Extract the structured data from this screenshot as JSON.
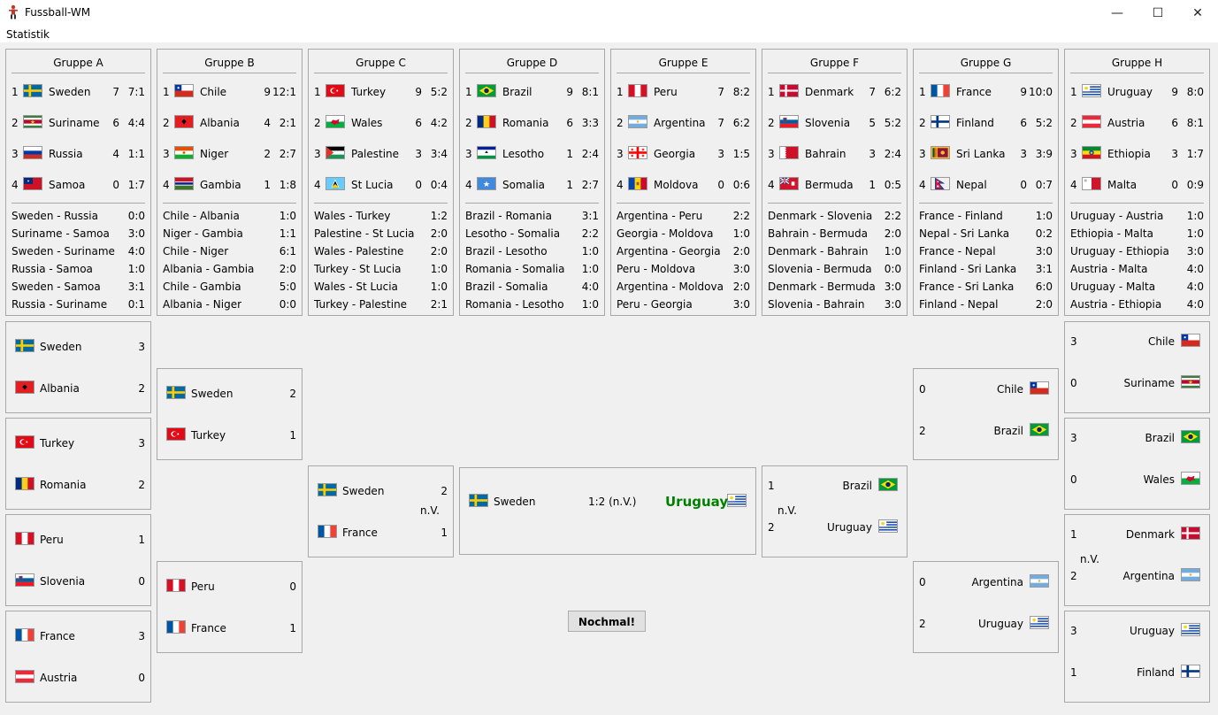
{
  "window": {
    "title": "Fussball-WM",
    "icon": "player-icon",
    "minimize": "—",
    "maximize": "☐",
    "close": "✕"
  },
  "menu": {
    "statistik": "Statistik"
  },
  "groups": [
    {
      "title": "Gruppe A",
      "standings": [
        {
          "pos": "1",
          "team": "Sweden",
          "pts": "7",
          "goals": "7:1"
        },
        {
          "pos": "2",
          "team": "Suriname",
          "pts": "6",
          "goals": "4:4"
        },
        {
          "pos": "3",
          "team": "Russia",
          "pts": "4",
          "goals": "1:1"
        },
        {
          "pos": "4",
          "team": "Samoa",
          "pts": "0",
          "goals": "1:7"
        }
      ],
      "matches": [
        {
          "pair": "Sweden - Russia",
          "result": "0:0"
        },
        {
          "pair": "Suriname - Samoa",
          "result": "3:0"
        },
        {
          "pair": "Sweden - Suriname",
          "result": "4:0"
        },
        {
          "pair": "Russia - Samoa",
          "result": "1:0"
        },
        {
          "pair": "Sweden - Samoa",
          "result": "3:1"
        },
        {
          "pair": "Russia - Suriname",
          "result": "0:1"
        }
      ]
    },
    {
      "title": "Gruppe B",
      "standings": [
        {
          "pos": "1",
          "team": "Chile",
          "pts": "9",
          "goals": "12:1"
        },
        {
          "pos": "2",
          "team": "Albania",
          "pts": "4",
          "goals": "2:1"
        },
        {
          "pos": "3",
          "team": "Niger",
          "pts": "2",
          "goals": "2:7"
        },
        {
          "pos": "4",
          "team": "Gambia",
          "pts": "1",
          "goals": "1:8"
        }
      ],
      "matches": [
        {
          "pair": "Chile - Albania",
          "result": "1:0"
        },
        {
          "pair": "Niger - Gambia",
          "result": "1:1"
        },
        {
          "pair": "Chile - Niger",
          "result": "6:1"
        },
        {
          "pair": "Albania - Gambia",
          "result": "2:0"
        },
        {
          "pair": "Chile - Gambia",
          "result": "5:0"
        },
        {
          "pair": "Albania - Niger",
          "result": "0:0"
        }
      ]
    },
    {
      "title": "Gruppe C",
      "standings": [
        {
          "pos": "1",
          "team": "Turkey",
          "pts": "9",
          "goals": "5:2"
        },
        {
          "pos": "2",
          "team": "Wales",
          "pts": "6",
          "goals": "4:2"
        },
        {
          "pos": "3",
          "team": "Palestine",
          "pts": "3",
          "goals": "3:4"
        },
        {
          "pos": "4",
          "team": "St Lucia",
          "pts": "0",
          "goals": "0:4"
        }
      ],
      "matches": [
        {
          "pair": "Wales - Turkey",
          "result": "1:2"
        },
        {
          "pair": "Palestine - St Lucia",
          "result": "2:0"
        },
        {
          "pair": "Wales - Palestine",
          "result": "2:0"
        },
        {
          "pair": "Turkey - St Lucia",
          "result": "1:0"
        },
        {
          "pair": "Wales - St Lucia",
          "result": "1:0"
        },
        {
          "pair": "Turkey - Palestine",
          "result": "2:1"
        }
      ]
    },
    {
      "title": "Gruppe D",
      "standings": [
        {
          "pos": "1",
          "team": "Brazil",
          "pts": "9",
          "goals": "8:1"
        },
        {
          "pos": "2",
          "team": "Romania",
          "pts": "6",
          "goals": "3:3"
        },
        {
          "pos": "3",
          "team": "Lesotho",
          "pts": "1",
          "goals": "2:4"
        },
        {
          "pos": "4",
          "team": "Somalia",
          "pts": "1",
          "goals": "2:7"
        }
      ],
      "matches": [
        {
          "pair": "Brazil - Romania",
          "result": "3:1"
        },
        {
          "pair": "Lesotho - Somalia",
          "result": "2:2"
        },
        {
          "pair": "Brazil - Lesotho",
          "result": "1:0"
        },
        {
          "pair": "Romania - Somalia",
          "result": "1:0"
        },
        {
          "pair": "Brazil - Somalia",
          "result": "4:0"
        },
        {
          "pair": "Romania - Lesotho",
          "result": "1:0"
        }
      ]
    },
    {
      "title": "Gruppe E",
      "standings": [
        {
          "pos": "1",
          "team": "Peru",
          "pts": "7",
          "goals": "8:2"
        },
        {
          "pos": "2",
          "team": "Argentina",
          "pts": "7",
          "goals": "6:2"
        },
        {
          "pos": "3",
          "team": "Georgia",
          "pts": "3",
          "goals": "1:5"
        },
        {
          "pos": "4",
          "team": "Moldova",
          "pts": "0",
          "goals": "0:6"
        }
      ],
      "matches": [
        {
          "pair": "Argentina - Peru",
          "result": "2:2"
        },
        {
          "pair": "Georgia - Moldova",
          "result": "1:0"
        },
        {
          "pair": "Argentina - Georgia",
          "result": "2:0"
        },
        {
          "pair": "Peru - Moldova",
          "result": "3:0"
        },
        {
          "pair": "Argentina - Moldova",
          "result": "2:0"
        },
        {
          "pair": "Peru - Georgia",
          "result": "3:0"
        }
      ]
    },
    {
      "title": "Gruppe F",
      "standings": [
        {
          "pos": "1",
          "team": "Denmark",
          "pts": "7",
          "goals": "6:2"
        },
        {
          "pos": "2",
          "team": "Slovenia",
          "pts": "5",
          "goals": "5:2"
        },
        {
          "pos": "3",
          "team": "Bahrain",
          "pts": "3",
          "goals": "2:4"
        },
        {
          "pos": "4",
          "team": "Bermuda",
          "pts": "1",
          "goals": "0:5"
        }
      ],
      "matches": [
        {
          "pair": "Denmark - Slovenia",
          "result": "2:2"
        },
        {
          "pair": "Bahrain - Bermuda",
          "result": "2:0"
        },
        {
          "pair": "Denmark - Bahrain",
          "result": "1:0"
        },
        {
          "pair": "Slovenia - Bermuda",
          "result": "0:0"
        },
        {
          "pair": "Denmark - Bermuda",
          "result": "3:0"
        },
        {
          "pair": "Slovenia - Bahrain",
          "result": "3:0"
        }
      ]
    },
    {
      "title": "Gruppe G",
      "standings": [
        {
          "pos": "1",
          "team": "France",
          "pts": "9",
          "goals": "10:0"
        },
        {
          "pos": "2",
          "team": "Finland",
          "pts": "6",
          "goals": "5:2"
        },
        {
          "pos": "3",
          "team": "Sri Lanka",
          "pts": "3",
          "goals": "3:9"
        },
        {
          "pos": "4",
          "team": "Nepal",
          "pts": "0",
          "goals": "0:7"
        }
      ],
      "matches": [
        {
          "pair": "France - Finland",
          "result": "1:0"
        },
        {
          "pair": "Nepal - Sri Lanka",
          "result": "0:2"
        },
        {
          "pair": "France - Nepal",
          "result": "3:0"
        },
        {
          "pair": "Finland - Sri Lanka",
          "result": "3:1"
        },
        {
          "pair": "France - Sri Lanka",
          "result": "6:0"
        },
        {
          "pair": "Finland - Nepal",
          "result": "2:0"
        }
      ]
    },
    {
      "title": "Gruppe H",
      "standings": [
        {
          "pos": "1",
          "team": "Uruguay",
          "pts": "9",
          "goals": "8:0"
        },
        {
          "pos": "2",
          "team": "Austria",
          "pts": "6",
          "goals": "8:1"
        },
        {
          "pos": "3",
          "team": "Ethiopia",
          "pts": "3",
          "goals": "1:7"
        },
        {
          "pos": "4",
          "team": "Malta",
          "pts": "0",
          "goals": "0:9"
        }
      ],
      "matches": [
        {
          "pair": "Uruguay - Austria",
          "result": "1:0"
        },
        {
          "pair": "Ethiopia - Malta",
          "result": "1:0"
        },
        {
          "pair": "Uruguay - Ethiopia",
          "result": "3:0"
        },
        {
          "pair": "Austria - Malta",
          "result": "4:0"
        },
        {
          "pair": "Uruguay - Malta",
          "result": "4:0"
        },
        {
          "pair": "Austria - Ethiopia",
          "result": "4:0"
        }
      ]
    }
  ],
  "knockout": {
    "r16_left": [
      {
        "home": "Sweden",
        "home_score": "3",
        "away": "Albania",
        "away_score": "2",
        "note": ""
      },
      {
        "home": "Turkey",
        "home_score": "3",
        "away": "Romania",
        "away_score": "2",
        "note": ""
      },
      {
        "home": "Peru",
        "home_score": "1",
        "away": "Slovenia",
        "away_score": "0",
        "note": ""
      },
      {
        "home": "France",
        "home_score": "3",
        "away": "Austria",
        "away_score": "0",
        "note": ""
      }
    ],
    "qf_left": [
      {
        "home": "Sweden",
        "home_score": "2",
        "away": "Turkey",
        "away_score": "1",
        "note": ""
      },
      {
        "home": "Peru",
        "home_score": "0",
        "away": "France",
        "away_score": "1",
        "note": ""
      }
    ],
    "sf_left": [
      {
        "home": "Sweden",
        "home_score": "2",
        "away": "France",
        "away_score": "1",
        "note": "n.V."
      }
    ],
    "final": {
      "home": "Sweden",
      "score": "1:2 (n.V.)",
      "away": "Uruguay",
      "champion": "Uruguay"
    },
    "sf_right": [
      {
        "home": "Brazil",
        "home_score": "1",
        "away": "Uruguay",
        "away_score": "2",
        "note": "n.V."
      }
    ],
    "qf_right": [
      {
        "home": "Chile",
        "home_score": "0",
        "away": "Brazil",
        "away_score": "2",
        "note": ""
      },
      {
        "home": "Argentina",
        "home_score": "0",
        "away": "Uruguay",
        "away_score": "2",
        "note": ""
      }
    ],
    "r16_right": [
      {
        "home": "Chile",
        "home_score": "3",
        "away": "Suriname",
        "away_score": "0",
        "note": ""
      },
      {
        "home": "Brazil",
        "home_score": "3",
        "away": "Wales",
        "away_score": "0",
        "note": ""
      },
      {
        "home": "Denmark",
        "home_score": "1",
        "away": "Argentina",
        "away_score": "2",
        "note": "n.V."
      },
      {
        "home": "Uruguay",
        "home_score": "3",
        "away": "Finland",
        "away_score": "1",
        "note": ""
      }
    ]
  },
  "button": {
    "again": "Nochmal!"
  },
  "flag_icons": {
    "Sweden": "sweden-flag-icon",
    "Suriname": "suriname-flag-icon",
    "Russia": "russia-flag-icon",
    "Samoa": "samoa-flag-icon",
    "Chile": "chile-flag-icon",
    "Albania": "albania-flag-icon",
    "Niger": "niger-flag-icon",
    "Gambia": "gambia-flag-icon",
    "Turkey": "turkey-flag-icon",
    "Wales": "wales-flag-icon",
    "Palestine": "palestine-flag-icon",
    "St Lucia": "st-lucia-flag-icon",
    "Brazil": "brazil-flag-icon",
    "Romania": "romania-flag-icon",
    "Lesotho": "lesotho-flag-icon",
    "Somalia": "somalia-flag-icon",
    "Peru": "peru-flag-icon",
    "Argentina": "argentina-flag-icon",
    "Georgia": "georgia-flag-icon",
    "Moldova": "moldova-flag-icon",
    "Denmark": "denmark-flag-icon",
    "Slovenia": "slovenia-flag-icon",
    "Bahrain": "bahrain-flag-icon",
    "Bermuda": "bermuda-flag-icon",
    "France": "france-flag-icon",
    "Finland": "finland-flag-icon",
    "Sri Lanka": "sri-lanka-flag-icon",
    "Nepal": "nepal-flag-icon",
    "Uruguay": "uruguay-flag-icon",
    "Austria": "austria-flag-icon",
    "Ethiopia": "ethiopia-flag-icon",
    "Malta": "malta-flag-icon"
  },
  "colors": {
    "champion": "#008000",
    "panel_border": "#a8a8a8",
    "background": "#f0f0f0"
  }
}
